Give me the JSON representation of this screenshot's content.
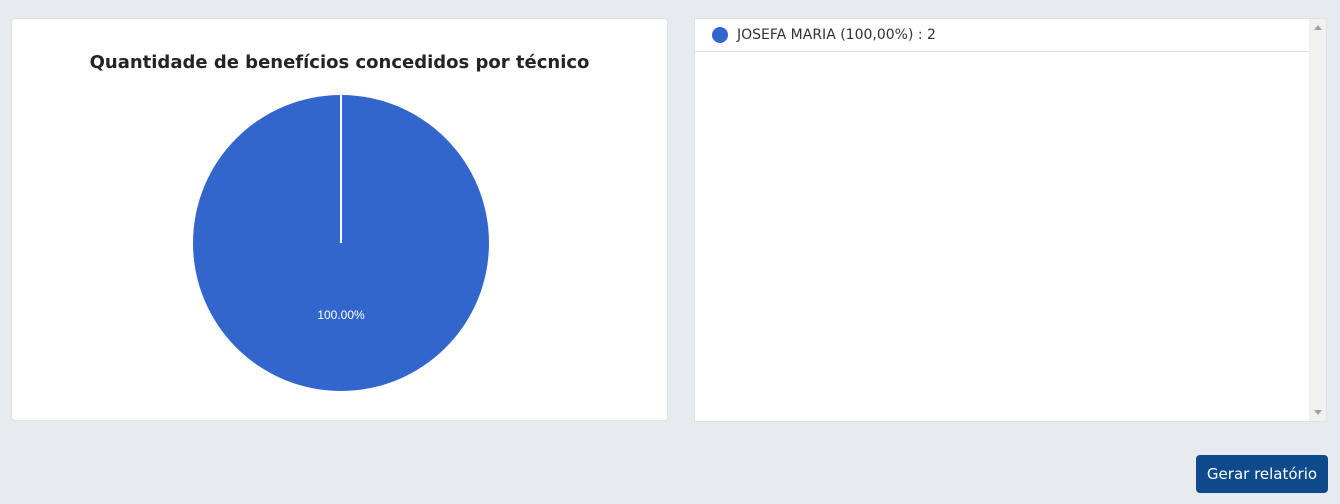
{
  "chart_data": {
    "type": "pie",
    "title": "Quantidade de benefícios concedidos por técnico",
    "categories": [
      "JOSEFA MARIA"
    ],
    "values": [
      2
    ],
    "slice_labels": [
      "100.00%"
    ],
    "colors": [
      "#3366cc"
    ]
  },
  "legend": {
    "items": [
      {
        "label": "JOSEFA MARIA (100,00%) : 2",
        "color": "#3366cc"
      }
    ]
  },
  "actions": {
    "report_button_label": "Gerar relatório"
  }
}
